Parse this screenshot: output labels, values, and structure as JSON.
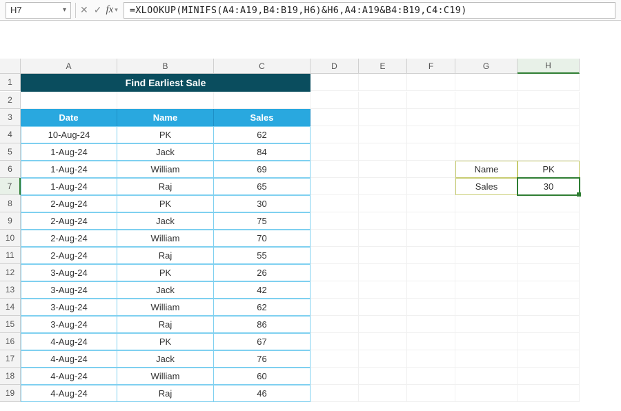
{
  "namebox": {
    "value": "H7"
  },
  "formula_bar": {
    "value": "=XLOOKUP(MINIFS(A4:A19,B4:B19,H6)&H6,A4:A19&B4:B19,C4:C19)"
  },
  "fx_label": "fx",
  "columns": [
    "A",
    "B",
    "C",
    "D",
    "E",
    "F",
    "G",
    "H"
  ],
  "rows": [
    "1",
    "2",
    "3",
    "4",
    "5",
    "6",
    "7",
    "8",
    "9",
    "10",
    "11",
    "12",
    "13",
    "14",
    "15",
    "16",
    "17",
    "18",
    "19"
  ],
  "title": "Find Earliest Sale",
  "headers": {
    "date": "Date",
    "name": "Name",
    "sales": "Sales"
  },
  "table": [
    {
      "date": "10-Aug-24",
      "name": "PK",
      "sales": "62"
    },
    {
      "date": "1-Aug-24",
      "name": "Jack",
      "sales": "84"
    },
    {
      "date": "1-Aug-24",
      "name": "William",
      "sales": "69"
    },
    {
      "date": "1-Aug-24",
      "name": "Raj",
      "sales": "65"
    },
    {
      "date": "2-Aug-24",
      "name": "PK",
      "sales": "30"
    },
    {
      "date": "2-Aug-24",
      "name": "Jack",
      "sales": "75"
    },
    {
      "date": "2-Aug-24",
      "name": "William",
      "sales": "70"
    },
    {
      "date": "2-Aug-24",
      "name": "Raj",
      "sales": "55"
    },
    {
      "date": "3-Aug-24",
      "name": "PK",
      "sales": "26"
    },
    {
      "date": "3-Aug-24",
      "name": "Jack",
      "sales": "42"
    },
    {
      "date": "3-Aug-24",
      "name": "William",
      "sales": "62"
    },
    {
      "date": "3-Aug-24",
      "name": "Raj",
      "sales": "86"
    },
    {
      "date": "4-Aug-24",
      "name": "PK",
      "sales": "67"
    },
    {
      "date": "4-Aug-24",
      "name": "Jack",
      "sales": "76"
    },
    {
      "date": "4-Aug-24",
      "name": "William",
      "sales": "60"
    },
    {
      "date": "4-Aug-24",
      "name": "Raj",
      "sales": "46"
    }
  ],
  "lookup": {
    "name_label": "Name",
    "name_value": "PK",
    "sales_label": "Sales",
    "sales_value": "30"
  },
  "active_col": "H",
  "active_row": "7"
}
